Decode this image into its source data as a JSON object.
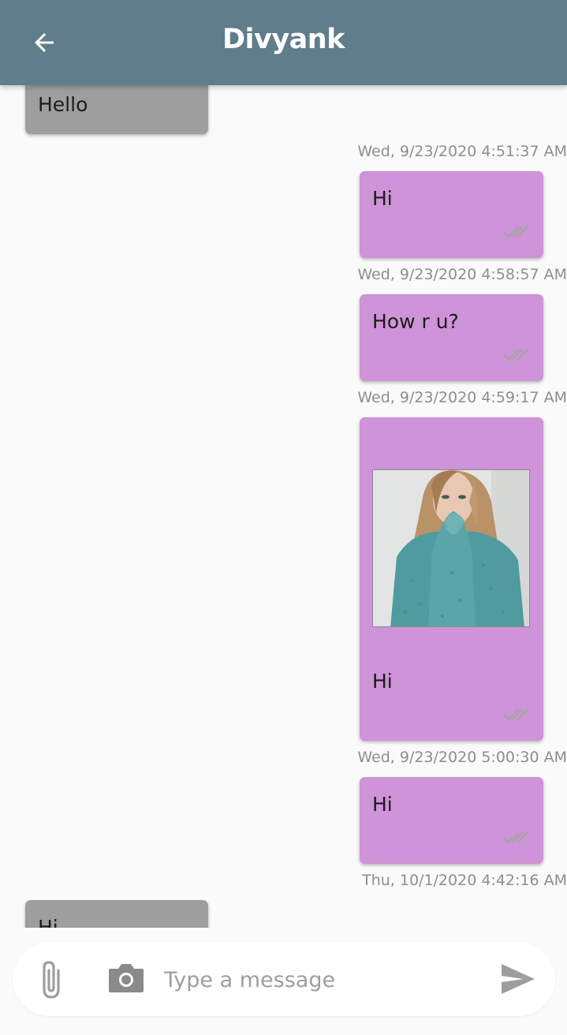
{
  "header": {
    "title": "Divyank",
    "back_icon": "arrow-left-icon",
    "background_color": "#607d8b"
  },
  "messages": [
    {
      "direction": "incoming",
      "text": "Hello",
      "timestamp": ""
    },
    {
      "direction": "outgoing",
      "text": "Hi",
      "timestamp": "Wed, 9/23/2020 4:51:37 AM",
      "status": "double-check-icon"
    },
    {
      "direction": "outgoing",
      "text": "How r u?",
      "timestamp": "Wed, 9/23/2020 4:58:57 AM",
      "status": "double-check-icon"
    },
    {
      "direction": "outgoing",
      "text": "Hi",
      "timestamp": "Wed, 9/23/2020 4:59:17 AM",
      "status": "double-check-icon",
      "has_image": true
    },
    {
      "direction": "outgoing",
      "text": "Hi",
      "timestamp": "Wed, 9/23/2020 5:00:30 AM",
      "status": "double-check-icon"
    },
    {
      "direction": "incoming",
      "text": "Hi",
      "timestamp": "Thu, 10/1/2020 4:42:16 AM"
    }
  ],
  "colors": {
    "incoming_bubble": "#9e9e9e",
    "outgoing_bubble": "#ce93d8",
    "timestamp_text": "#8e8e8e"
  },
  "composer": {
    "placeholder": "Type a message",
    "value": "",
    "attach_icon": "paperclip-icon",
    "camera_icon": "camera-icon",
    "send_icon": "send-icon"
  }
}
